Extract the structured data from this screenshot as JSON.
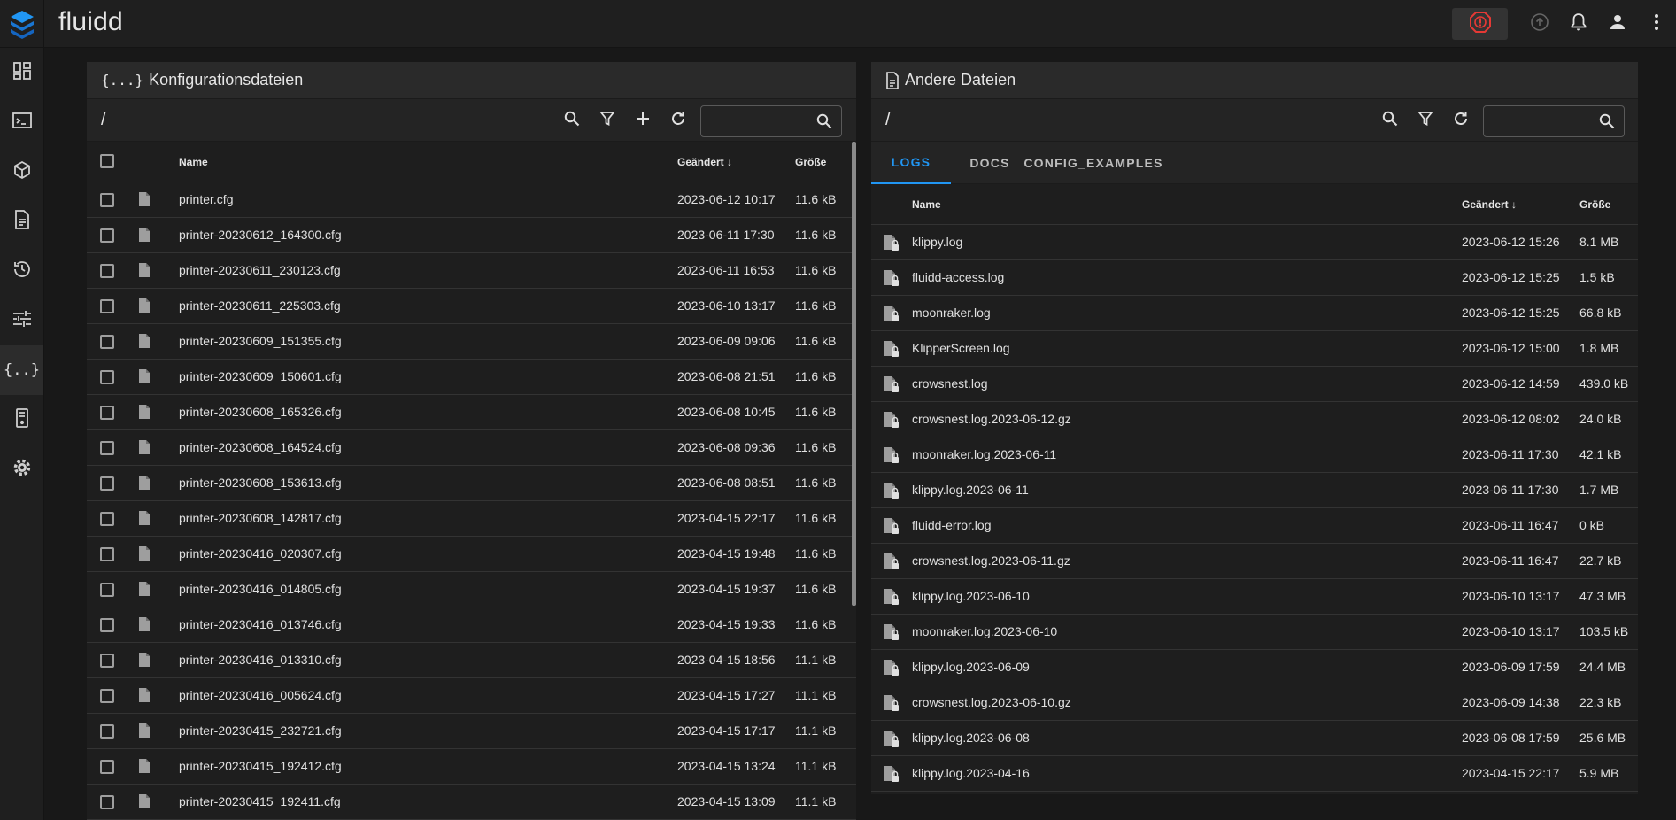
{
  "app": {
    "title": "fluidd"
  },
  "colors": {
    "accent": "#2196f3",
    "emergency": "#e53935"
  },
  "topbar": {
    "icons": [
      "emergency-stop-icon",
      "upload-icon",
      "bell-icon",
      "account-icon",
      "more-vert-icon"
    ]
  },
  "sidebar": {
    "items": [
      {
        "name": "dashboard-icon"
      },
      {
        "name": "console-icon"
      },
      {
        "name": "cube-icon"
      },
      {
        "name": "jobs-icon"
      },
      {
        "name": "history-icon"
      },
      {
        "name": "tune-icon"
      },
      {
        "name": "config-braces-icon",
        "active": true
      },
      {
        "name": "system-icon"
      },
      {
        "name": "settings-icon"
      }
    ]
  },
  "config_panel": {
    "header_icon": "{...}",
    "title": "Konfigurationsdateien",
    "path": "/",
    "search_placeholder": "",
    "columns": {
      "name": "Name",
      "modified": "Geändert",
      "size": "Größe"
    },
    "rows": [
      {
        "name": "printer.cfg",
        "modified": "2023-06-12 10:17",
        "size": "11.6 kB"
      },
      {
        "name": "printer-20230612_164300.cfg",
        "modified": "2023-06-11 17:30",
        "size": "11.6 kB"
      },
      {
        "name": "printer-20230611_230123.cfg",
        "modified": "2023-06-11 16:53",
        "size": "11.6 kB"
      },
      {
        "name": "printer-20230611_225303.cfg",
        "modified": "2023-06-10 13:17",
        "size": "11.6 kB"
      },
      {
        "name": "printer-20230609_151355.cfg",
        "modified": "2023-06-09 09:06",
        "size": "11.6 kB"
      },
      {
        "name": "printer-20230609_150601.cfg",
        "modified": "2023-06-08 21:51",
        "size": "11.6 kB"
      },
      {
        "name": "printer-20230608_165326.cfg",
        "modified": "2023-06-08 10:45",
        "size": "11.6 kB"
      },
      {
        "name": "printer-20230608_164524.cfg",
        "modified": "2023-06-08 09:36",
        "size": "11.6 kB"
      },
      {
        "name": "printer-20230608_153613.cfg",
        "modified": "2023-06-08 08:51",
        "size": "11.6 kB"
      },
      {
        "name": "printer-20230608_142817.cfg",
        "modified": "2023-04-15 22:17",
        "size": "11.6 kB"
      },
      {
        "name": "printer-20230416_020307.cfg",
        "modified": "2023-04-15 19:48",
        "size": "11.6 kB"
      },
      {
        "name": "printer-20230416_014805.cfg",
        "modified": "2023-04-15 19:37",
        "size": "11.6 kB"
      },
      {
        "name": "printer-20230416_013746.cfg",
        "modified": "2023-04-15 19:33",
        "size": "11.6 kB"
      },
      {
        "name": "printer-20230416_013310.cfg",
        "modified": "2023-04-15 18:56",
        "size": "11.1 kB"
      },
      {
        "name": "printer-20230416_005624.cfg",
        "modified": "2023-04-15 17:27",
        "size": "11.1 kB"
      },
      {
        "name": "printer-20230415_232721.cfg",
        "modified": "2023-04-15 17:17",
        "size": "11.1 kB"
      },
      {
        "name": "printer-20230415_192412.cfg",
        "modified": "2023-04-15 13:24",
        "size": "11.1 kB"
      },
      {
        "name": "printer-20230415_192411.cfg",
        "modified": "2023-04-15 13:09",
        "size": "11.1 kB"
      }
    ]
  },
  "other_panel": {
    "title": "Andere Dateien",
    "path": "/",
    "search_placeholder": "",
    "tabs": [
      {
        "label": "LOGS",
        "active": true
      },
      {
        "label": "DOCS",
        "active": false
      },
      {
        "label": "CONFIG_EXAMPLES",
        "active": false
      }
    ],
    "columns": {
      "name": "Name",
      "modified": "Geändert",
      "size": "Größe"
    },
    "rows": [
      {
        "name": "klippy.log",
        "modified": "2023-06-12 15:26",
        "size": "8.1 MB"
      },
      {
        "name": "fluidd-access.log",
        "modified": "2023-06-12 15:25",
        "size": "1.5 kB"
      },
      {
        "name": "moonraker.log",
        "modified": "2023-06-12 15:25",
        "size": "66.8 kB"
      },
      {
        "name": "KlipperScreen.log",
        "modified": "2023-06-12 15:00",
        "size": "1.8 MB"
      },
      {
        "name": "crowsnest.log",
        "modified": "2023-06-12 14:59",
        "size": "439.0 kB"
      },
      {
        "name": "crowsnest.log.2023-06-12.gz",
        "modified": "2023-06-12 08:02",
        "size": "24.0 kB"
      },
      {
        "name": "moonraker.log.2023-06-11",
        "modified": "2023-06-11 17:30",
        "size": "42.1 kB"
      },
      {
        "name": "klippy.log.2023-06-11",
        "modified": "2023-06-11 17:30",
        "size": "1.7 MB"
      },
      {
        "name": "fluidd-error.log",
        "modified": "2023-06-11 16:47",
        "size": "0 kB"
      },
      {
        "name": "crowsnest.log.2023-06-11.gz",
        "modified": "2023-06-11 16:47",
        "size": "22.7 kB"
      },
      {
        "name": "klippy.log.2023-06-10",
        "modified": "2023-06-10 13:17",
        "size": "47.3 MB"
      },
      {
        "name": "moonraker.log.2023-06-10",
        "modified": "2023-06-10 13:17",
        "size": "103.5 kB"
      },
      {
        "name": "klippy.log.2023-06-09",
        "modified": "2023-06-09 17:59",
        "size": "24.4 MB"
      },
      {
        "name": "crowsnest.log.2023-06-10.gz",
        "modified": "2023-06-09 14:38",
        "size": "22.3 kB"
      },
      {
        "name": "klippy.log.2023-06-08",
        "modified": "2023-06-08 17:59",
        "size": "25.6 MB"
      },
      {
        "name": "klippy.log.2023-04-16",
        "modified": "2023-04-15 22:17",
        "size": "5.9 MB"
      }
    ]
  }
}
